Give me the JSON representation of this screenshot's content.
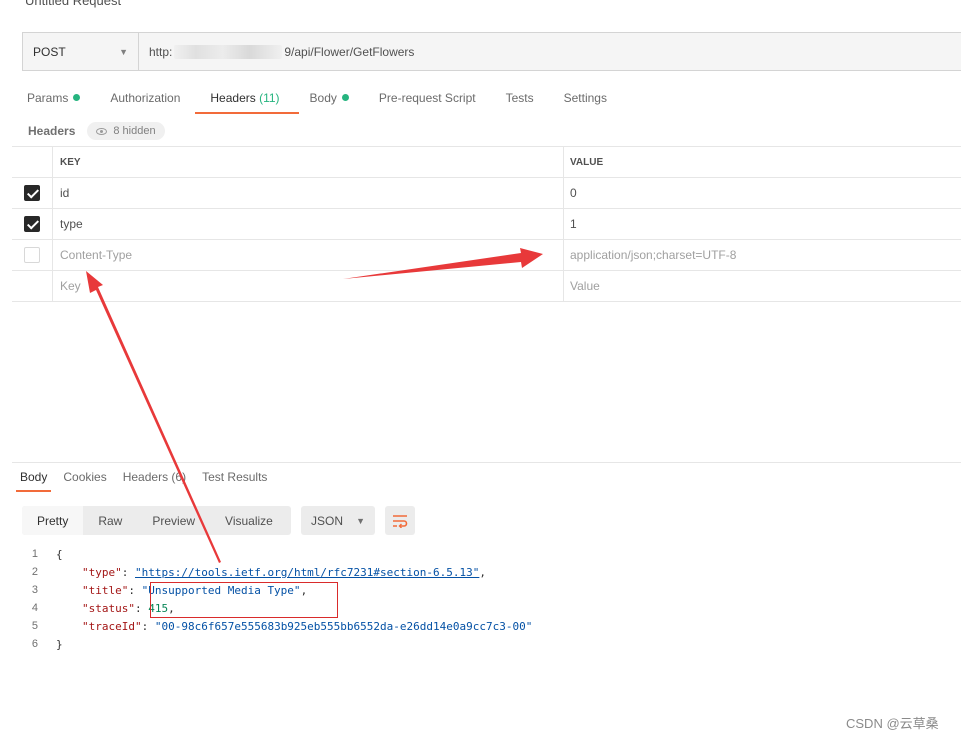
{
  "request": {
    "title": "Untitled Request",
    "method": "POST",
    "url_prefix": "http:",
    "url_suffix": "9/api/Flower/GetFlowers"
  },
  "req_tabs": [
    {
      "label": "Params",
      "dot": true
    },
    {
      "label": "Authorization"
    },
    {
      "label": "Headers",
      "count": "(11)",
      "active": true
    },
    {
      "label": "Body",
      "dot": true
    },
    {
      "label": "Pre-request Script"
    },
    {
      "label": "Tests"
    },
    {
      "label": "Settings"
    }
  ],
  "headers_section": {
    "label": "Headers",
    "hidden": "8 hidden"
  },
  "table": {
    "col_key": "KEY",
    "col_value": "VALUE",
    "rows": [
      {
        "key": "id",
        "value": "0",
        "checked": true
      },
      {
        "key": "type",
        "value": "1",
        "checked": true
      },
      {
        "key": "Content-Type",
        "value": "application/json;charset=UTF-8",
        "checked": false
      }
    ],
    "placeholder_key": "Key",
    "placeholder_value": "Value"
  },
  "resp_tabs": [
    {
      "label": "Body",
      "active": true
    },
    {
      "label": "Cookies"
    },
    {
      "label": "Headers (6)"
    },
    {
      "label": "Test Results"
    }
  ],
  "format": {
    "buttons": [
      "Pretty",
      "Raw",
      "Preview",
      "Visualize"
    ],
    "language": "JSON"
  },
  "code": {
    "line_numbers": [
      "1",
      "2",
      "3",
      "4",
      "5",
      "6"
    ],
    "open": "{",
    "close": "}",
    "type_key": "\"type\"",
    "type_val": "\"https://tools.ietf.org/html/rfc7231#section-6.5.13\"",
    "title_key": "\"title\"",
    "title_val": "\"Unsupported Media Type\"",
    "status_key": "\"status\"",
    "status_val": "415",
    "trace_key": "\"traceId\"",
    "trace_val": "\"00-98c6f657e555683b925eb555bb6552da-e26dd14e0a9cc7c3-00\""
  },
  "watermark": "CSDN @云草桑",
  "colors": {
    "accent": "#f26b3a",
    "dot": "#26b47f",
    "annotation": "#e8393a"
  },
  "icons": [
    "chevron-down-icon",
    "eye-icon",
    "checkbox-icon",
    "wrap-lines-icon",
    "arrow-annotation"
  ]
}
